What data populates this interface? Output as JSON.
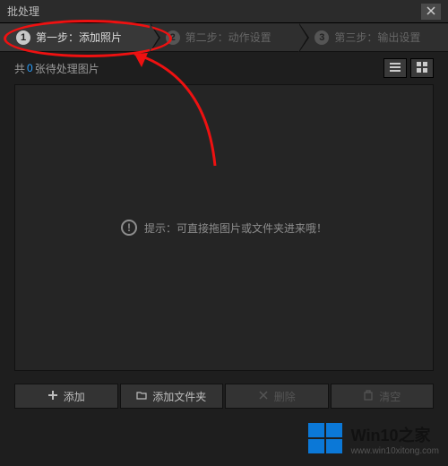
{
  "window": {
    "title": "批处理"
  },
  "steps": [
    {
      "num": "1",
      "label": "第一步：添加照片",
      "active": true
    },
    {
      "num": "2",
      "label": "第二步：动作设置",
      "active": false
    },
    {
      "num": "3",
      "label": "第三步：输出设置",
      "active": false
    }
  ],
  "toolbar": {
    "prefix": "共 ",
    "count": "0",
    "suffix": " 张待处理图片"
  },
  "hint": {
    "icon": "!",
    "text": "提示：可直接拖图片或文件夹进来哦！"
  },
  "buttons": {
    "add": "添加",
    "addFolder": "添加文件夹",
    "delete": "删除",
    "clear": "清空"
  },
  "watermark": {
    "title": "Win10之家",
    "url": "www.win10xitong.com"
  }
}
